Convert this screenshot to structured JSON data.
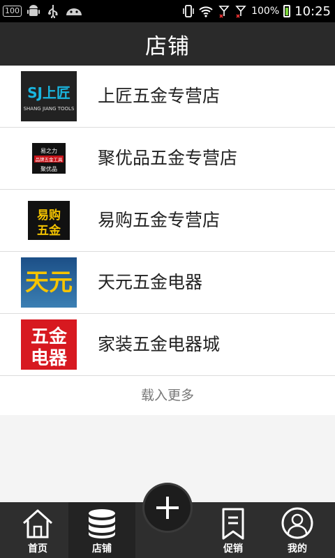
{
  "status_bar": {
    "badge": "100",
    "battery_percent": "100%",
    "time": "10:25",
    "icons": [
      "android-icon",
      "usb-icon",
      "android-robot-icon",
      "vibrate-icon",
      "wifi-icon",
      "signal-1-icon",
      "signal-2-icon",
      "battery-icon"
    ]
  },
  "header": {
    "title": "店铺"
  },
  "stores": [
    {
      "name": "上匠五金专营店",
      "logo_text": "SJ上匠",
      "logo_sub": "SHANG JIANG TOOLS"
    },
    {
      "name": "聚优品五金专营店",
      "logo_text": "易之力",
      "logo_sub": "品牌五金工具"
    },
    {
      "name": "易购五金专营店",
      "logo_text": "易购",
      "logo_sub": "五金"
    },
    {
      "name": "天元五金电器",
      "logo_text": "天元"
    },
    {
      "name": "家装五金电器城",
      "logo_text": "五金",
      "logo_sub": "电器"
    }
  ],
  "list": {
    "load_more": "载入更多"
  },
  "bottom_nav": {
    "home": "首页",
    "shop": "店铺",
    "promo": "促销",
    "mine": "我的",
    "active": "shop"
  },
  "colors": {
    "header_bg": "#2a2a2a",
    "nav_bg": "#2e2e2e"
  }
}
